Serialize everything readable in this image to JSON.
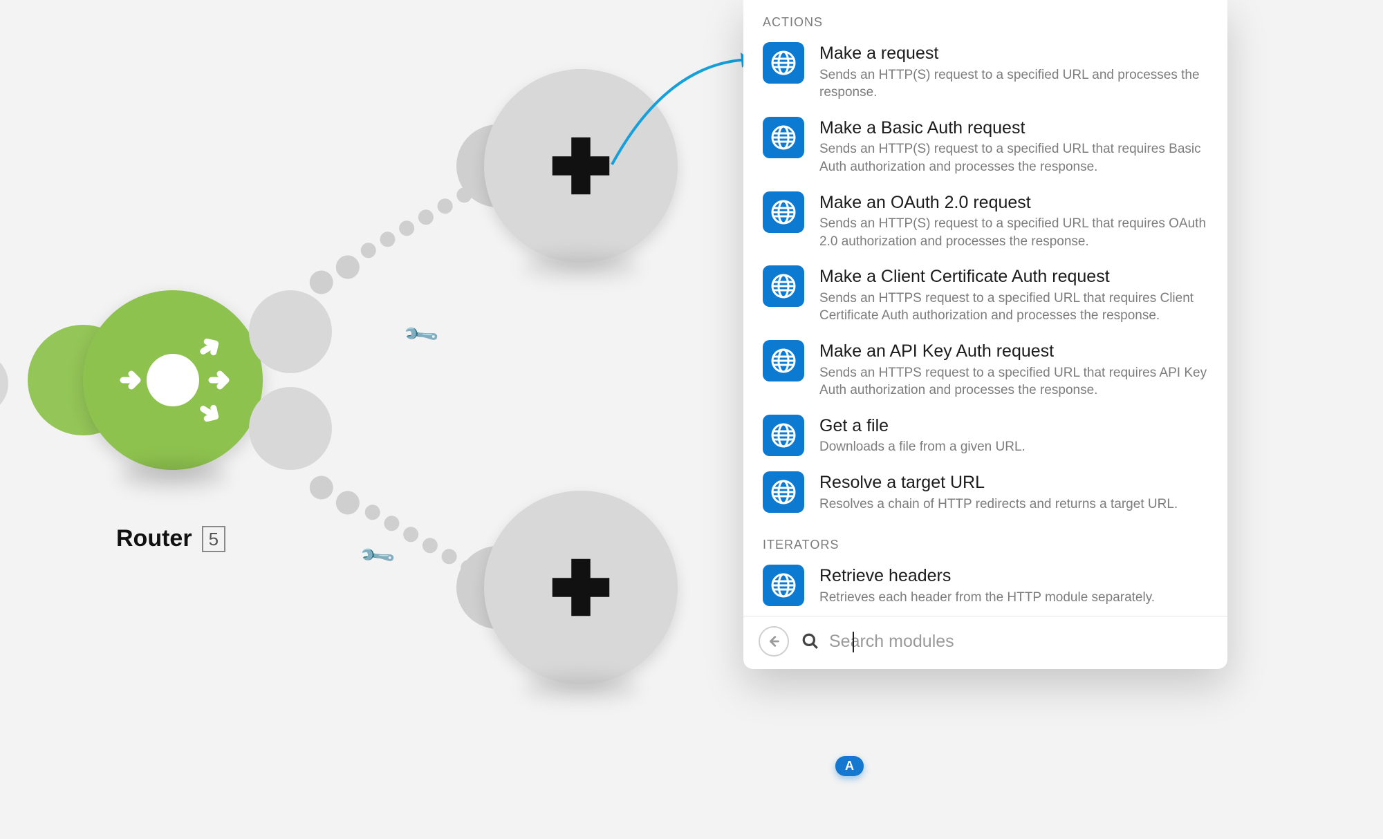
{
  "router": {
    "label": "Router",
    "number": "5"
  },
  "panel": {
    "sections": [
      {
        "label": "ACTIONS",
        "items": [
          {
            "title": "Make a request",
            "desc": "Sends an HTTP(S) request to a specified URL and processes the response."
          },
          {
            "title": "Make a Basic Auth request",
            "desc": "Sends an HTTP(S) request to a specified URL that requires Basic Auth authorization and processes the response."
          },
          {
            "title": "Make an OAuth 2.0 request",
            "desc": "Sends an HTTP(S) request to a specified URL that requires OAuth 2.0 authorization and processes the response."
          },
          {
            "title": "Make a Client Certificate Auth request",
            "desc": "Sends an HTTPS request to a specified URL that requires Client Certificate Auth authorization and processes the response."
          },
          {
            "title": "Make an API Key Auth request",
            "desc": "Sends an HTTPS request to a specified URL that requires API Key Auth authorization and processes the response."
          },
          {
            "title": "Get a file",
            "desc": "Downloads a file from a given URL."
          },
          {
            "title": "Resolve a target URL",
            "desc": "Resolves a chain of HTTP redirects and returns a target URL."
          }
        ]
      },
      {
        "label": "ITERATORS",
        "items": [
          {
            "title": "Retrieve headers",
            "desc": "Retrieves each header from the HTTP module separately."
          }
        ]
      }
    ],
    "search_placeholder": "Search modules",
    "keyboard_hint": "A"
  }
}
